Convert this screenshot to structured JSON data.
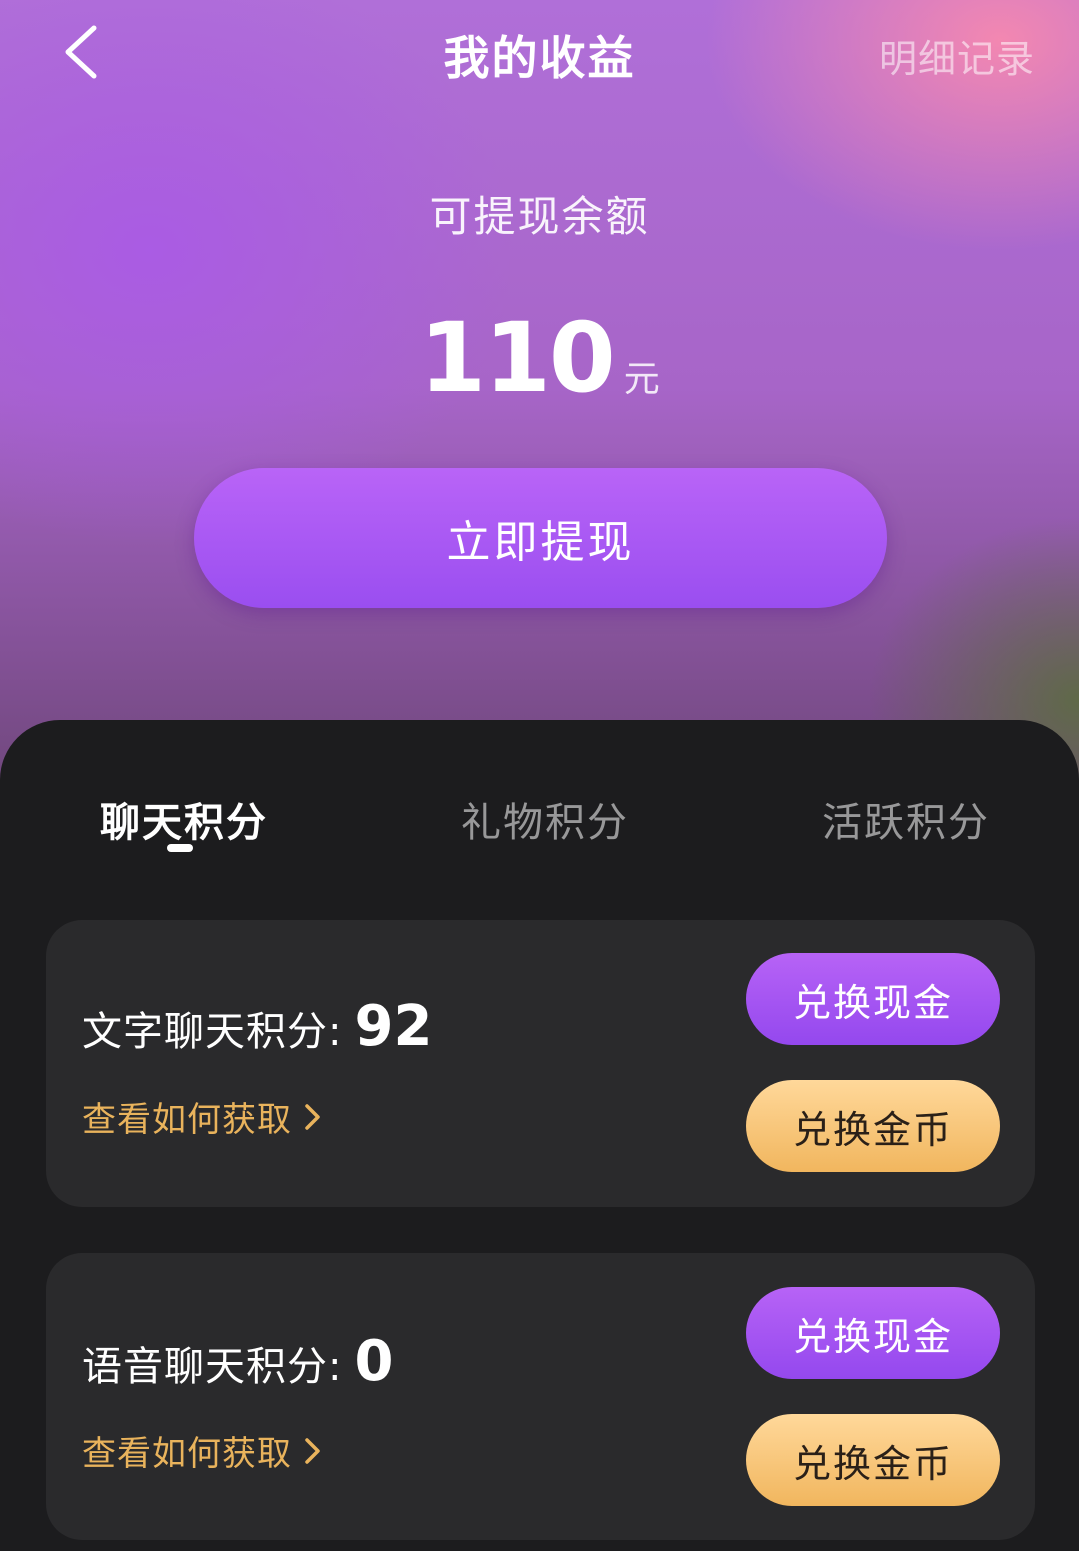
{
  "header": {
    "title": "我的收益",
    "details_link": "明细记录"
  },
  "balance": {
    "label": "可提现余额",
    "amount": "110",
    "unit": "元",
    "withdraw_label": "立即提现"
  },
  "tabs": [
    {
      "label": "聊天积分",
      "active": true
    },
    {
      "label": "礼物积分",
      "active": false
    },
    {
      "label": "活跃积分",
      "active": false
    }
  ],
  "cards": [
    {
      "label": "文字聊天积分:",
      "value": "92",
      "how_link": "查看如何获取",
      "cash_button": "兑换现金",
      "coin_button": "兑换金币"
    },
    {
      "label": "语音聊天积分:",
      "value": "0",
      "how_link": "查看如何获取",
      "cash_button": "兑换现金",
      "coin_button": "兑换金币"
    }
  ],
  "colors": {
    "accent_purple": "#9a4ef0",
    "accent_gold": "#f1b65e",
    "link_gold": "#e9b35c",
    "panel_bg": "#1c1c1e",
    "card_bg": "#2a2a2c"
  }
}
